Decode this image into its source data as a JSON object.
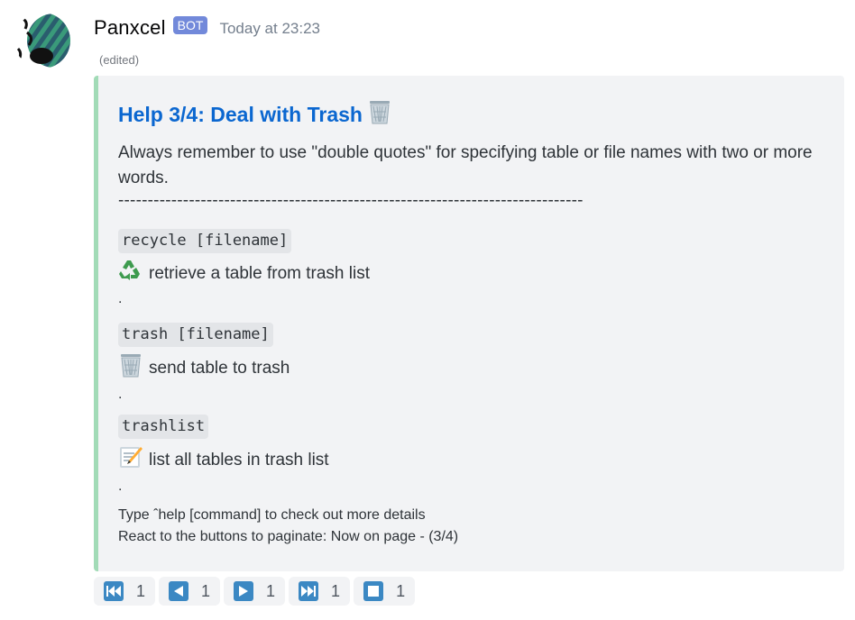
{
  "author": {
    "username": "Panxcel",
    "bot_tag": "BOT",
    "timestamp": "Today at 23:23",
    "edited": "(edited)"
  },
  "embed": {
    "title": "Help 3/4: Deal with Trash",
    "title_emoji": "wastebasket-icon",
    "description": "Always remember to use \"double quotes\" for specifying table or file names with two or more words.",
    "separator": "-------------------------------------------------------------------------------",
    "commands": [
      {
        "code": "recycle [filename]",
        "icon": "recycle-icon",
        "text": "retrieve a table from trash list",
        "dot": "."
      },
      {
        "code": "trash [filename]",
        "icon": "wastebasket-icon",
        "text": "send table to trash",
        "dot": "."
      },
      {
        "code": "trashlist ",
        "icon": "memo-icon",
        "text": "list all tables in trash list",
        "dot": "."
      }
    ],
    "footer_line1": "Type ˆhelp [command] to check out more details",
    "footer_line2": "React to the buttons to paginate: Now on page - (3/4)",
    "accent_color": "#a2dbb7",
    "title_color": "#0b67d0"
  },
  "reactions": [
    {
      "icon": "track-previous-icon",
      "count": "1"
    },
    {
      "icon": "arrow-backward-icon",
      "count": "1"
    },
    {
      "icon": "arrow-forward-icon",
      "count": "1"
    },
    {
      "icon": "track-next-icon",
      "count": "1"
    },
    {
      "icon": "stop-button-icon",
      "count": "1"
    }
  ]
}
